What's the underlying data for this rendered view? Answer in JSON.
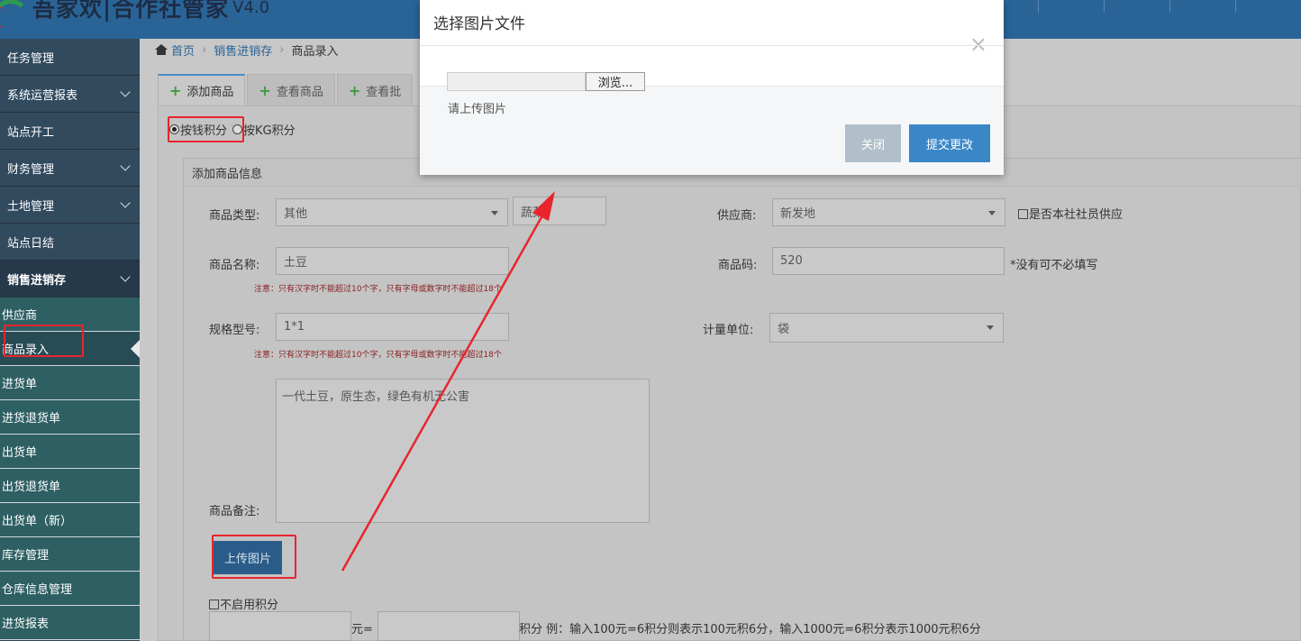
{
  "app": {
    "title": "吾家欢|合作社管家",
    "version": "V4.0"
  },
  "sidebar": {
    "main_items": [
      {
        "label": "任务管理",
        "has_children": false
      },
      {
        "label": "系统运营报表",
        "has_children": true
      },
      {
        "label": "站点开工",
        "has_children": false
      },
      {
        "label": "财务管理",
        "has_children": true
      },
      {
        "label": "土地管理",
        "has_children": true
      },
      {
        "label": "站点日结",
        "has_children": false
      },
      {
        "label": "销售进销存",
        "has_children": true
      }
    ],
    "sub_items": [
      {
        "label": "供应商"
      },
      {
        "label": "商品录入"
      },
      {
        "label": "进货单"
      },
      {
        "label": "进货退货单"
      },
      {
        "label": "出货单"
      },
      {
        "label": "出货退货单"
      },
      {
        "label": "出货单（新）"
      },
      {
        "label": "库存管理"
      },
      {
        "label": "仓库信息管理"
      },
      {
        "label": "进货报表"
      }
    ]
  },
  "breadcrumb": {
    "home": "首页",
    "section": "销售进销存",
    "current": "商品录入"
  },
  "tabs": [
    {
      "label": "添加商品"
    },
    {
      "label": "查看商品"
    },
    {
      "label": "查看批"
    }
  ],
  "form": {
    "radio_money": "按钱积分",
    "radio_kg": "按KG积分",
    "panel_title": "添加商品信息",
    "type_label": "商品类型:",
    "type_value": "其他",
    "type_extra": "蔬菜",
    "supplier_label": "供应商:",
    "supplier_value": "新发地",
    "member_supply_label": "是否本社社员供应",
    "name_label": "商品名称:",
    "name_value": "土豆",
    "code_label": "商品码:",
    "code_value": "520",
    "code_hint": "*没有可不必填写",
    "note_text": "注意：只有汉字时不能超过10个字，只有字母或数字时不能超过18个",
    "spec_label": "规格型号:",
    "spec_value": "1*1",
    "unit_label": "计量单位:",
    "unit_value": "袋",
    "remark_label": "商品备注:",
    "remark_value": "一代土豆，原生态，绿色有机无公害",
    "upload_button": "上传图片",
    "disable_points_label": "不启用积分",
    "yuan_eq": "元=",
    "points_example": "积分 例：输入100元=6积分则表示100元积6分，输入1000元=6积分表示1000元积6分"
  },
  "modal": {
    "title": "选择图片文件",
    "close_symbol": "×",
    "browse_label": "浏览...",
    "hint": "请上传图片",
    "close_button": "关闭",
    "submit_button": "提交更改"
  },
  "colors": {
    "header": "#2a6496",
    "sidebar": "#2f4050",
    "annotation_red": "#e8252e",
    "submit": "#3a87c8"
  }
}
